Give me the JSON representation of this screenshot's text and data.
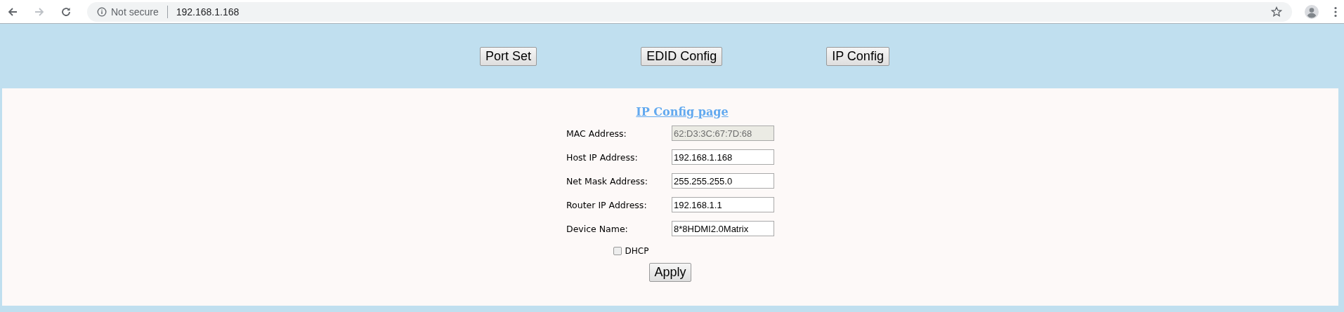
{
  "browser": {
    "security": "Not secure",
    "url": "192.168.1.168"
  },
  "nav_buttons": [
    "Port Set",
    "EDID Config",
    "IP Config"
  ],
  "title": "IP Config page",
  "fields": [
    {
      "label": "MAC Address:",
      "value": "62:D3:3C:67:7D:68",
      "disabled": true
    },
    {
      "label": "Host IP Address:",
      "value": "192.168.1.168",
      "disabled": false
    },
    {
      "label": "Net Mask Address:",
      "value": "255.255.255.0",
      "disabled": false
    },
    {
      "label": "Router IP Address:",
      "value": "192.168.1.1",
      "disabled": false
    },
    {
      "label": "Device Name:",
      "value": "8*8HDMI2.0Matrix",
      "disabled": false
    }
  ],
  "dhcp": {
    "label": "DHCP",
    "checked": false
  },
  "apply_button": "Apply"
}
